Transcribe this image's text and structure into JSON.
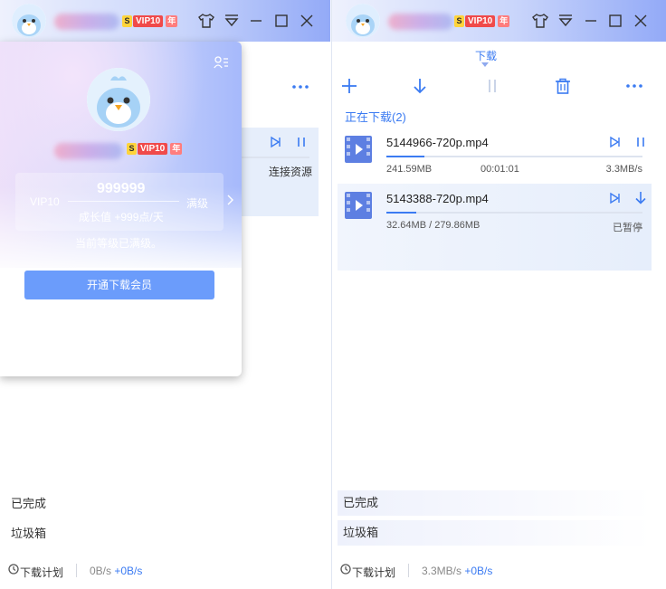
{
  "colors": {
    "accent": "#3b7bf2",
    "button": "#6b9cfb",
    "vip_red": "#f04a4a",
    "gold": "#ffd43b"
  },
  "vip_badge": {
    "s": "S",
    "vip": "VIP10",
    "year": "年"
  },
  "left": {
    "popup": {
      "vip_label": "VIP10",
      "points": "999999",
      "max_label": "满级",
      "growth": "成长值 +999点/天",
      "status": "当前等级已满级。",
      "button": "开通下载会员"
    },
    "connecting": "连接资源",
    "completed": "已完成",
    "trash": "垃圾箱",
    "footer": {
      "plan": "下载计划",
      "speed": "0B/s",
      "upload": "+0B/s"
    }
  },
  "right": {
    "tab": "下载",
    "section": "正在下载(2)",
    "items": [
      {
        "name": "5144966-720p.mp4",
        "size": "241.59MB",
        "time": "00:01:01",
        "speed": "3.3MB/s",
        "progress": 0.15
      },
      {
        "name": "5143388-720p.mp4",
        "size": "32.64MB / 279.86MB",
        "time": "",
        "speed": "已暂停",
        "progress": 0.117
      }
    ],
    "completed": "已完成",
    "trash": "垃圾箱",
    "footer": {
      "plan": "下载计划",
      "speed": "3.3MB/s",
      "upload": "+0B/s"
    }
  }
}
